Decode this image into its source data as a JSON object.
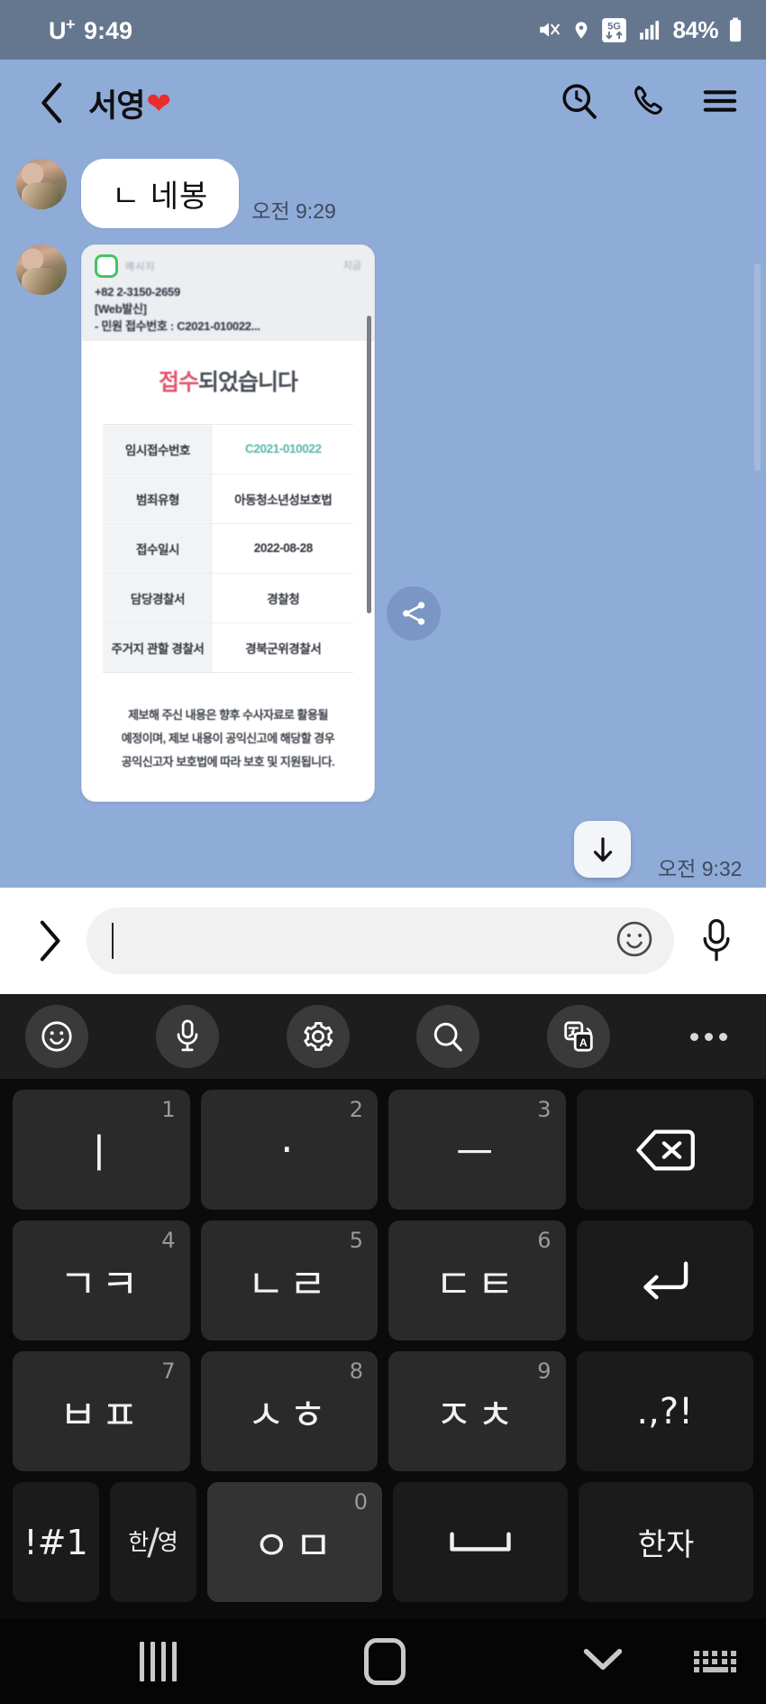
{
  "status_bar": {
    "carrier": "U",
    "carrier_sup": "+",
    "time": "9:49",
    "battery_percent": "84%",
    "network": "5G",
    "icons": [
      "mute-icon",
      "location-icon",
      "network-5g-icon",
      "signal-bars-icon",
      "battery-icon"
    ]
  },
  "header": {
    "back_label": "‹",
    "title": "서영",
    "title_emoji": "❤",
    "actions": [
      "search-history-icon",
      "call-icon",
      "menu-icon"
    ]
  },
  "chat": {
    "messages": [
      {
        "type": "text",
        "sender": "other",
        "text": "ㄴ 네봉",
        "time": "오전 9:29"
      },
      {
        "type": "image",
        "sender": "other",
        "time": "오전 9:32",
        "screenshot": {
          "app_label": "메시지",
          "time_label": "지금",
          "sms_lines": [
            "+82 2-3150-2659",
            "[Web발신]",
            "- 민원 접수번호 : C2021-010022..."
          ],
          "heading_red": "접수",
          "heading_gray": "되었습니다",
          "table": [
            {
              "key": "임시접수번호",
              "value": "C2021-010022",
              "accent": true
            },
            {
              "key": "범죄유형",
              "value": "아동청소년성보호법",
              "accent": false
            },
            {
              "key": "접수일시",
              "value": "2022-08-28",
              "accent": false
            },
            {
              "key": "담당경찰서",
              "value": "경찰청",
              "accent": false
            },
            {
              "key": "주거지 관할 경찰서",
              "value": "경북군위경찰서",
              "accent": false
            }
          ],
          "note_lines": [
            "제보해 주신 내용은 향후 수사자료로 활용될",
            "예정이며, 제보 내용이 공익신고에 해당할 경우",
            "공익신고자 보호법에 따라 보호 및 지원됩니다."
          ]
        }
      }
    ],
    "share_button": "share-icon",
    "scroll_to_bottom": "arrow-down-icon"
  },
  "input_bar": {
    "expand_label": "›",
    "placeholder": "",
    "value": "",
    "emoji_icon": "emoji-smile-icon",
    "mic_icon": "microphone-icon"
  },
  "keyboard": {
    "toolbar": [
      {
        "name": "emoji-sticker-button",
        "icon": "emoji-smile-icon"
      },
      {
        "name": "voice-input-button",
        "icon": "microphone-icon"
      },
      {
        "name": "keyboard-settings-button",
        "icon": "gear-icon"
      },
      {
        "name": "keyboard-search-button",
        "icon": "search-icon"
      },
      {
        "name": "translate-button",
        "icon": "translate-icon"
      },
      {
        "name": "more-options-button",
        "icon": "more-dots-icon"
      }
    ],
    "rows": [
      [
        {
          "label": "ㅣ",
          "num": "1",
          "style": "key"
        },
        {
          "label": "·",
          "num": "2",
          "style": "key"
        },
        {
          "label": "ㅡ",
          "num": "3",
          "style": "key"
        },
        {
          "label": "⌫",
          "num": "",
          "style": "dark",
          "name": "backspace-key"
        }
      ],
      [
        {
          "label": "ㄱㅋ",
          "num": "4",
          "style": "key"
        },
        {
          "label": "ㄴㄹ",
          "num": "5",
          "style": "key"
        },
        {
          "label": "ㄷㅌ",
          "num": "6",
          "style": "key"
        },
        {
          "label": "↵",
          "num": "",
          "style": "dark",
          "name": "enter-key"
        }
      ],
      [
        {
          "label": "ㅂㅍ",
          "num": "7",
          "style": "key"
        },
        {
          "label": "ㅅㅎ",
          "num": "8",
          "style": "key"
        },
        {
          "label": "ㅈㅊ",
          "num": "9",
          "style": "key"
        },
        {
          "label": ".,?!",
          "num": "",
          "style": "dark",
          "name": "punctuation-key"
        }
      ]
    ],
    "bottom_row": {
      "symbols": "!#1",
      "lang_top": "한",
      "lang_bottom": "영",
      "consonant": "ㅇㅁ",
      "consonant_num": "0",
      "space": "⌴",
      "hanja": "한자"
    }
  },
  "nav_bar": {
    "recents": "recents-icon",
    "home": "home-icon",
    "back_down": "hide-keyboard-icon",
    "keyboard_switch": "keyboard-switch-icon"
  },
  "colors": {
    "status_bar": "#65768f",
    "chat_background": "#8fabd8",
    "accent_teal": "#57b8a9",
    "accent_red": "#e0566f",
    "heart_red": "#ec2b2b"
  }
}
